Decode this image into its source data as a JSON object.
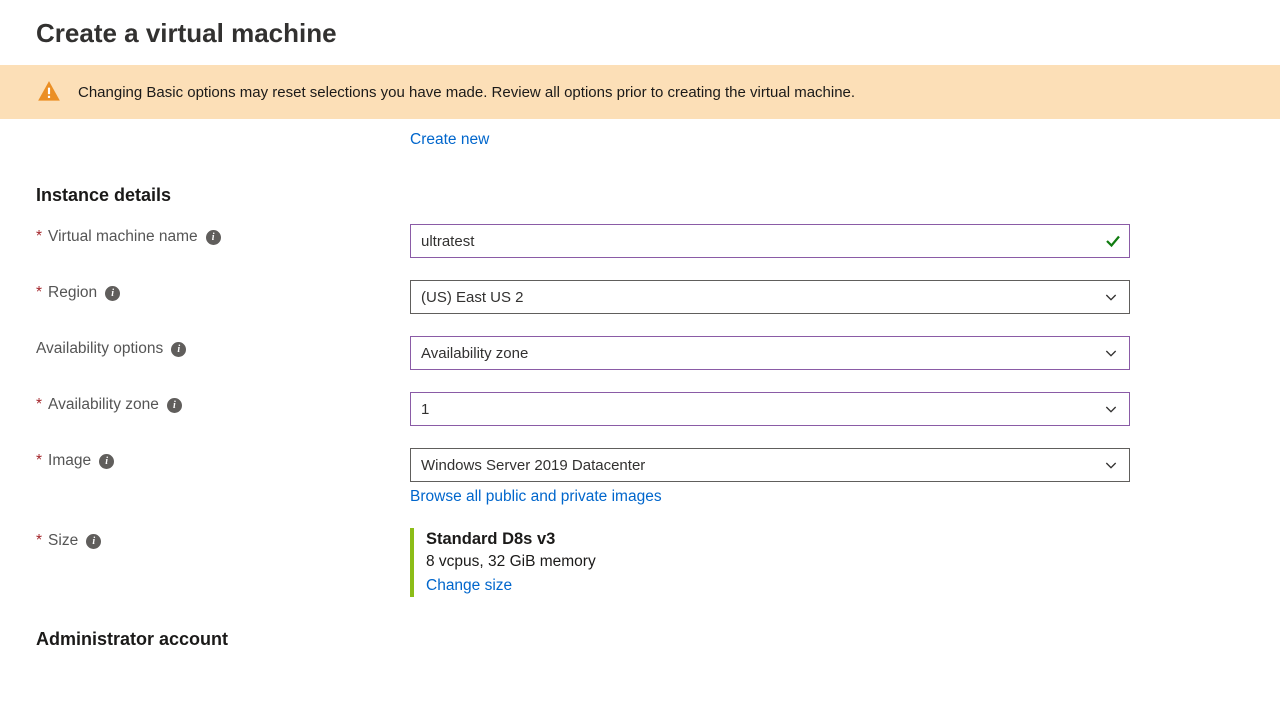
{
  "page": {
    "title": "Create a virtual machine"
  },
  "banner": {
    "message": "Changing Basic options may reset selections you have made. Review all options prior to creating the virtual machine."
  },
  "links": {
    "create_new": "Create new",
    "browse_images": "Browse all public and private images",
    "change_size": "Change size"
  },
  "sections": {
    "instance_details": "Instance details",
    "admin_account": "Administrator account"
  },
  "fields": {
    "vm_name": {
      "label": "Virtual machine name",
      "value": "ultratest",
      "required": true
    },
    "region": {
      "label": "Region",
      "value": "(US) East US 2",
      "required": true
    },
    "avail_options": {
      "label": "Availability options",
      "value": "Availability zone",
      "required": false
    },
    "avail_zone": {
      "label": "Availability zone",
      "value": "1",
      "required": true
    },
    "image": {
      "label": "Image",
      "value": "Windows Server 2019 Datacenter",
      "required": true
    },
    "size": {
      "label": "Size",
      "name": "Standard D8s v3",
      "spec": "8 vcpus, 32 GiB memory",
      "required": true
    }
  }
}
